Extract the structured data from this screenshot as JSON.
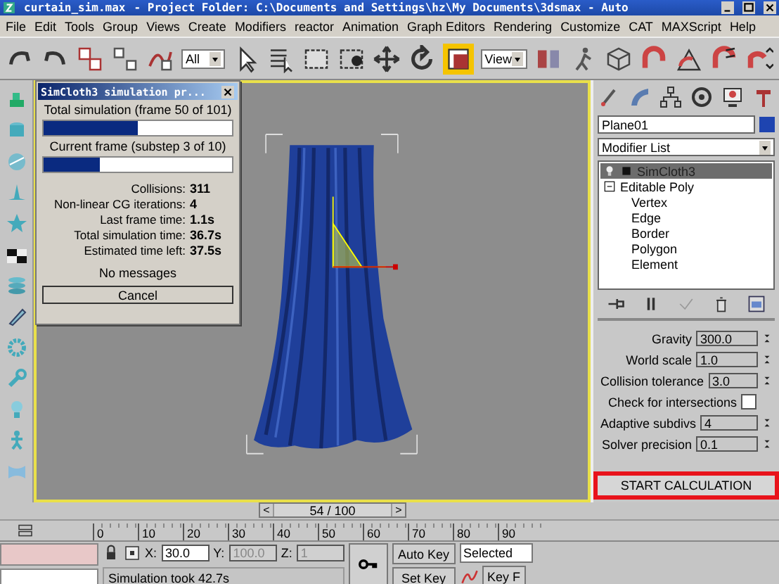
{
  "window": {
    "title": "curtain_sim.max",
    "project": "- Project Folder: C:\\Documents and Settings\\hz\\My Documents\\3dsmax   - Auto"
  },
  "menu": [
    "File",
    "Edit",
    "Tools",
    "Group",
    "Views",
    "Create",
    "Modifiers",
    "reactor",
    "Animation",
    "Graph Editors",
    "Rendering",
    "Customize",
    "CAT",
    "MAXScript",
    "Help"
  ],
  "toolbar": {
    "selection_filter": "All",
    "reference_coord": "View"
  },
  "dialog": {
    "title": "SimCloth3 simulation pr...",
    "progress": [
      {
        "label": "Total simulation (frame 50 of 101)",
        "level": 0.5
      },
      {
        "label": "Current frame (substep 3 of 10)",
        "level": 0.3
      }
    ],
    "stats": [
      {
        "label": "Collisions:",
        "value": "311"
      },
      {
        "label": "Non-linear CG iterations:",
        "value": "4"
      },
      {
        "label": "Last frame time:",
        "value": "1.1s"
      },
      {
        "label": "Total simulation time:",
        "value": "36.7s"
      },
      {
        "label": "Estimated time left:",
        "value": "37.5s"
      }
    ],
    "message": "No messages",
    "cancel": "Cancel"
  },
  "command_panel": {
    "object_name": "Plane01",
    "modifier_list": "Modifier List",
    "stack": [
      {
        "kind": "modifier",
        "label": "SimCloth3",
        "selected": true
      },
      {
        "kind": "object",
        "label": "Editable Poly",
        "selected": false,
        "expanded": true,
        "children": [
          {
            "label": "Vertex",
            "selected": false
          },
          {
            "label": "Edge",
            "selected": false
          },
          {
            "label": "Border",
            "selected": false
          },
          {
            "label": "Polygon",
            "selected": false
          },
          {
            "label": "Element",
            "selected": false
          }
        ]
      }
    ],
    "params": [
      {
        "kind": "spinner",
        "label": "Gravity",
        "value": "300.0"
      },
      {
        "kind": "spinner",
        "label": "World scale",
        "value": "1.0"
      },
      {
        "kind": "spinner",
        "label": "Collision tolerance",
        "value": "3.0"
      },
      {
        "kind": "check",
        "label": "Check for intersections",
        "checked": false
      },
      {
        "kind": "spinner",
        "label": "Adaptive subdivs",
        "value": "4"
      },
      {
        "kind": "spinner",
        "label": "Solver precision",
        "value": "0.1"
      }
    ],
    "start_button": "START CALCULATION"
  },
  "time_slider": {
    "label": "54 / 100",
    "prev": "<",
    "next": ">"
  },
  "timeline": {
    "ticks": [
      "0",
      "10",
      "20",
      "30",
      "40",
      "50",
      "60",
      "70",
      "80",
      "90"
    ]
  },
  "status": {
    "coords": [
      {
        "axis": "X:",
        "value": "30.0",
        "disabled": false
      },
      {
        "axis": "Y:",
        "value": "100.0",
        "disabled": true
      },
      {
        "axis": "Z:",
        "value": "1",
        "disabled": true
      }
    ],
    "auto_key": "Auto Key",
    "set_key": "Set Key",
    "key_mode": "Selected",
    "key_filters": "Key F",
    "prompt": "Simulation took 42.7s"
  }
}
